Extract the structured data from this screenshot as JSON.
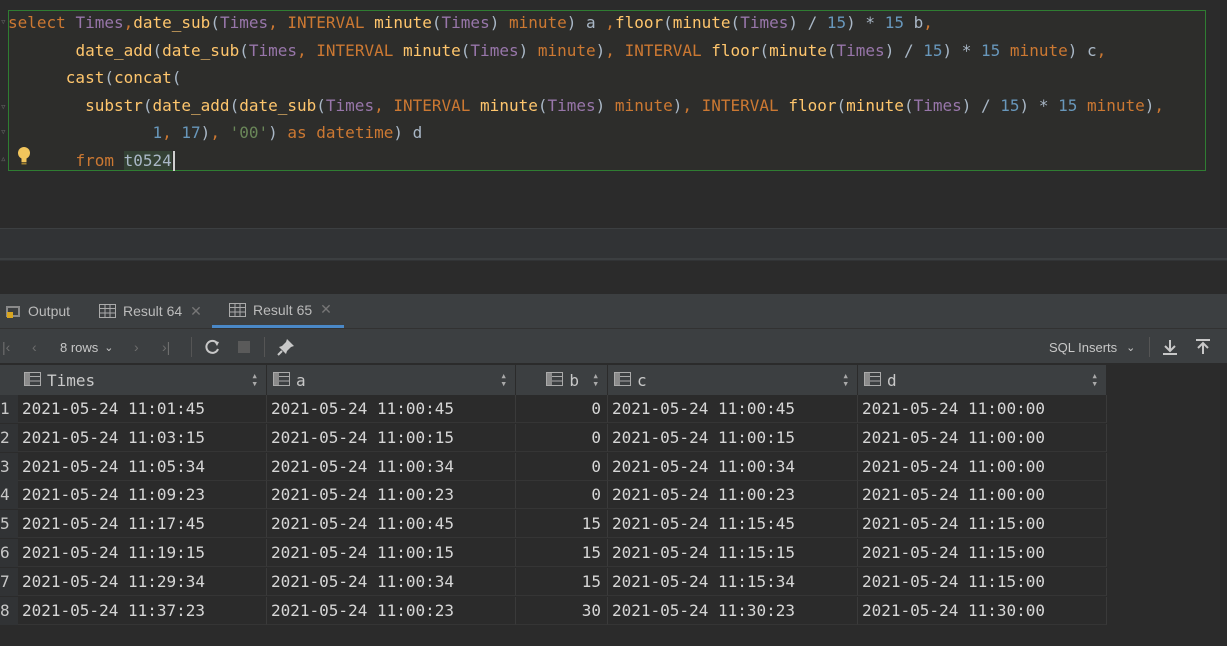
{
  "editor": {
    "lines": [
      [
        {
          "t": "select ",
          "c": "kw"
        },
        {
          "t": "Times",
          "c": "col"
        },
        {
          "t": ",",
          "c": "kw"
        },
        {
          "t": "date_sub",
          "c": "fn"
        },
        {
          "t": "(",
          "c": "plain"
        },
        {
          "t": "Times",
          "c": "col"
        },
        {
          "t": ", ",
          "c": "kw"
        },
        {
          "t": "INTERVAL ",
          "c": "kw"
        },
        {
          "t": "minute",
          "c": "fn"
        },
        {
          "t": "(",
          "c": "plain"
        },
        {
          "t": "Times",
          "c": "col"
        },
        {
          "t": ") ",
          "c": "plain"
        },
        {
          "t": "minute",
          "c": "kw"
        },
        {
          "t": ") a ",
          "c": "plain"
        },
        {
          "t": ",",
          "c": "kw"
        },
        {
          "t": "floor",
          "c": "fn"
        },
        {
          "t": "(",
          "c": "plain"
        },
        {
          "t": "minute",
          "c": "fn"
        },
        {
          "t": "(",
          "c": "plain"
        },
        {
          "t": "Times",
          "c": "col"
        },
        {
          "t": ") / ",
          "c": "plain"
        },
        {
          "t": "15",
          "c": "num"
        },
        {
          "t": ") * ",
          "c": "plain"
        },
        {
          "t": "15",
          "c": "num"
        },
        {
          "t": " b",
          "c": "plain"
        },
        {
          "t": ",",
          "c": "kw"
        }
      ],
      [
        {
          "t": "       ",
          "c": "plain"
        },
        {
          "t": "date_add",
          "c": "fn"
        },
        {
          "t": "(",
          "c": "plain"
        },
        {
          "t": "date_sub",
          "c": "fn"
        },
        {
          "t": "(",
          "c": "plain"
        },
        {
          "t": "Times",
          "c": "col"
        },
        {
          "t": ", ",
          "c": "kw"
        },
        {
          "t": "INTERVAL ",
          "c": "kw"
        },
        {
          "t": "minute",
          "c": "fn"
        },
        {
          "t": "(",
          "c": "plain"
        },
        {
          "t": "Times",
          "c": "col"
        },
        {
          "t": ") ",
          "c": "plain"
        },
        {
          "t": "minute",
          "c": "kw"
        },
        {
          "t": ")",
          "c": "plain"
        },
        {
          "t": ", ",
          "c": "kw"
        },
        {
          "t": "INTERVAL ",
          "c": "kw"
        },
        {
          "t": "floor",
          "c": "fn"
        },
        {
          "t": "(",
          "c": "plain"
        },
        {
          "t": "minute",
          "c": "fn"
        },
        {
          "t": "(",
          "c": "plain"
        },
        {
          "t": "Times",
          "c": "col"
        },
        {
          "t": ") / ",
          "c": "plain"
        },
        {
          "t": "15",
          "c": "num"
        },
        {
          "t": ") * ",
          "c": "plain"
        },
        {
          "t": "15",
          "c": "num"
        },
        {
          "t": " ",
          "c": "plain"
        },
        {
          "t": "minute",
          "c": "kw"
        },
        {
          "t": ") c",
          "c": "plain"
        },
        {
          "t": ",",
          "c": "kw"
        }
      ],
      [
        {
          "t": "      ",
          "c": "plain"
        },
        {
          "t": "cast",
          "c": "fn"
        },
        {
          "t": "(",
          "c": "plain"
        },
        {
          "t": "concat",
          "c": "fn"
        },
        {
          "t": "(",
          "c": "plain"
        }
      ],
      [
        {
          "t": "        ",
          "c": "plain"
        },
        {
          "t": "substr",
          "c": "fn"
        },
        {
          "t": "(",
          "c": "plain"
        },
        {
          "t": "date_add",
          "c": "fn"
        },
        {
          "t": "(",
          "c": "plain"
        },
        {
          "t": "date_sub",
          "c": "fn"
        },
        {
          "t": "(",
          "c": "plain"
        },
        {
          "t": "Times",
          "c": "col"
        },
        {
          "t": ", ",
          "c": "kw"
        },
        {
          "t": "INTERVAL ",
          "c": "kw"
        },
        {
          "t": "minute",
          "c": "fn"
        },
        {
          "t": "(",
          "c": "plain"
        },
        {
          "t": "Times",
          "c": "col"
        },
        {
          "t": ") ",
          "c": "plain"
        },
        {
          "t": "minute",
          "c": "kw"
        },
        {
          "t": ")",
          "c": "plain"
        },
        {
          "t": ", ",
          "c": "kw"
        },
        {
          "t": "INTERVAL ",
          "c": "kw"
        },
        {
          "t": "floor",
          "c": "fn"
        },
        {
          "t": "(",
          "c": "plain"
        },
        {
          "t": "minute",
          "c": "fn"
        },
        {
          "t": "(",
          "c": "plain"
        },
        {
          "t": "Times",
          "c": "col"
        },
        {
          "t": ") / ",
          "c": "plain"
        },
        {
          "t": "15",
          "c": "num"
        },
        {
          "t": ") * ",
          "c": "plain"
        },
        {
          "t": "15",
          "c": "num"
        },
        {
          "t": " ",
          "c": "plain"
        },
        {
          "t": "minute",
          "c": "kw"
        },
        {
          "t": ")",
          "c": "plain"
        },
        {
          "t": ",",
          "c": "kw"
        }
      ],
      [
        {
          "t": "               ",
          "c": "plain"
        },
        {
          "t": "1",
          "c": "num"
        },
        {
          "t": ", ",
          "c": "kw"
        },
        {
          "t": "17",
          "c": "num"
        },
        {
          "t": ")",
          "c": "plain"
        },
        {
          "t": ", ",
          "c": "kw"
        },
        {
          "t": "'00'",
          "c": "str"
        },
        {
          "t": ") ",
          "c": "plain"
        },
        {
          "t": "as ",
          "c": "kw"
        },
        {
          "t": "datetime",
          "c": "kw"
        },
        {
          "t": ") d",
          "c": "plain"
        }
      ],
      [
        {
          "t": "       ",
          "c": "plain"
        },
        {
          "t": "from ",
          "c": "kw"
        },
        {
          "t": "t0524",
          "c": "plain",
          "hl": true
        }
      ]
    ]
  },
  "tabs": [
    {
      "label": "Output",
      "icon": "output-icon"
    },
    {
      "label": "Result 64",
      "icon": "table-icon",
      "close": "✕"
    },
    {
      "label": "Result 65",
      "icon": "table-icon",
      "close": "✕"
    }
  ],
  "toolbar": {
    "rows_label": "8 rows",
    "format_label": "SQL Inserts"
  },
  "grid": {
    "columns": [
      "Times",
      "a",
      "b",
      "c",
      "d"
    ],
    "rows": [
      [
        "1",
        "2021-05-24 11:01:45",
        "2021-05-24 11:00:45",
        "0",
        "2021-05-24 11:00:45",
        "2021-05-24 11:00:00"
      ],
      [
        "2",
        "2021-05-24 11:03:15",
        "2021-05-24 11:00:15",
        "0",
        "2021-05-24 11:00:15",
        "2021-05-24 11:00:00"
      ],
      [
        "3",
        "2021-05-24 11:05:34",
        "2021-05-24 11:00:34",
        "0",
        "2021-05-24 11:00:34",
        "2021-05-24 11:00:00"
      ],
      [
        "4",
        "2021-05-24 11:09:23",
        "2021-05-24 11:00:23",
        "0",
        "2021-05-24 11:00:23",
        "2021-05-24 11:00:00"
      ],
      [
        "5",
        "2021-05-24 11:17:45",
        "2021-05-24 11:00:45",
        "15",
        "2021-05-24 11:15:45",
        "2021-05-24 11:15:00"
      ],
      [
        "6",
        "2021-05-24 11:19:15",
        "2021-05-24 11:00:15",
        "15",
        "2021-05-24 11:15:15",
        "2021-05-24 11:15:00"
      ],
      [
        "7",
        "2021-05-24 11:29:34",
        "2021-05-24 11:00:34",
        "15",
        "2021-05-24 11:15:34",
        "2021-05-24 11:15:00"
      ],
      [
        "8",
        "2021-05-24 11:37:23",
        "2021-05-24 11:00:23",
        "30",
        "2021-05-24 11:30:23",
        "2021-05-24 11:30:00"
      ]
    ]
  }
}
